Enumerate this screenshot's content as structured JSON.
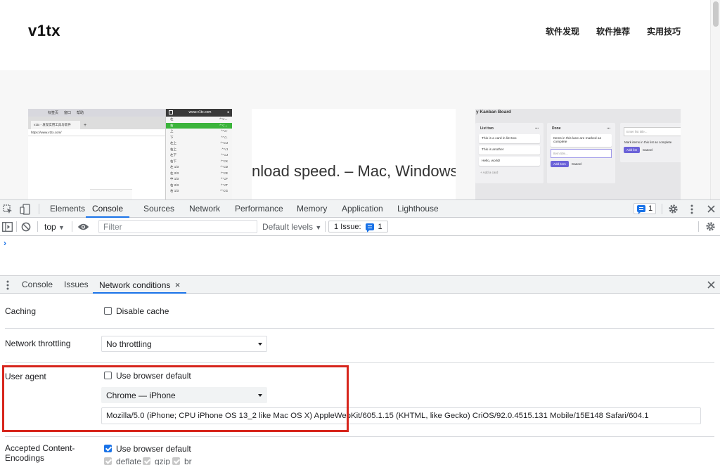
{
  "site": {
    "logo": "v1tx",
    "nav": [
      "软件发现",
      "软件推荐",
      "实用技巧"
    ],
    "card1": {
      "menubar": [
        "标签页",
        "窗口",
        "帮助"
      ],
      "tab_title": "v1tx - 发现实用工具与软件",
      "new_tab": "+",
      "url": "https://www.v1tx.com/",
      "menu_host": "www.v1tx.com",
      "menu_rows": [
        {
          "label": "左",
          "key": "^⌥←"
        },
        {
          "label": "右",
          "key": "^⌥→"
        },
        {
          "label": "上",
          "key": "^⌥↑"
        },
        {
          "label": "下",
          "key": "^⌥↓"
        },
        {
          "label": "左上",
          "key": "^⌥U"
        },
        {
          "label": "右上",
          "key": "^⌥I"
        },
        {
          "label": "左下",
          "key": "^⌥J"
        },
        {
          "label": "右下",
          "key": "^⌥K"
        },
        {
          "label": "左 1/3",
          "key": "^⌥D"
        },
        {
          "label": "左 2/3",
          "key": "^⌥E"
        },
        {
          "label": "中 1/3",
          "key": "^⌥F"
        },
        {
          "label": "右 2/3",
          "key": "^⌥T"
        },
        {
          "label": "右 1/3",
          "key": "^⌥G"
        }
      ]
    },
    "card2": {
      "text": "nload speed. – Mac, Windows"
    },
    "card3": {
      "title": "y Kanban Board",
      "col1": {
        "header": "List two",
        "items": [
          "This is a card in list two",
          "This is another",
          "Hello, world!"
        ],
        "add": "+ Add a card"
      },
      "col2": {
        "header": "Done",
        "items": [
          "Items in this lane are marked as complete"
        ],
        "placeholder": "Item title...",
        "add_btn": "Add item",
        "cancel": "Cancel"
      },
      "col3": {
        "placeholder": "Enter list title...",
        "note": "Mark items in this list as complete",
        "add_btn": "Add list",
        "cancel": "Cancel"
      }
    }
  },
  "devtools": {
    "tabs": [
      "Elements",
      "Console",
      "Sources",
      "Network",
      "Performance",
      "Memory",
      "Application",
      "Lighthouse"
    ],
    "active_tab": "Console",
    "issues_count": "1",
    "context": "top",
    "filter_placeholder": "Filter",
    "levels": "Default levels",
    "issues_label": "1 Issue:",
    "issues_badge": "1",
    "prompt": "›",
    "drawer_tabs": [
      "Console",
      "Issues",
      "Network conditions"
    ],
    "close_tab_glyph": "×"
  },
  "network_conditions": {
    "caching_label": "Caching",
    "disable_cache": "Disable cache",
    "throttling_label": "Network throttling",
    "throttling_value": "No throttling",
    "ua_label": "User agent",
    "ua_use_default": "Use browser default",
    "ua_preset": "Chrome — iPhone",
    "ua_string": "Mozilla/5.0 (iPhone; CPU iPhone OS 13_2 like Mac OS X) AppleWebKit/605.1.15 (KHTML, like Gecko) CriOS/92.0.4515.131 Mobile/15E148 Safari/604.1",
    "encodings_label": "Accepted Content-Encodings",
    "enc_use_default": "Use browser default",
    "encodings": [
      "deflate",
      "gzip",
      "br"
    ]
  },
  "colors": {
    "accent": "#1a73e8",
    "highlight": "#d7251c",
    "kanban_button": "#6b62d8"
  }
}
